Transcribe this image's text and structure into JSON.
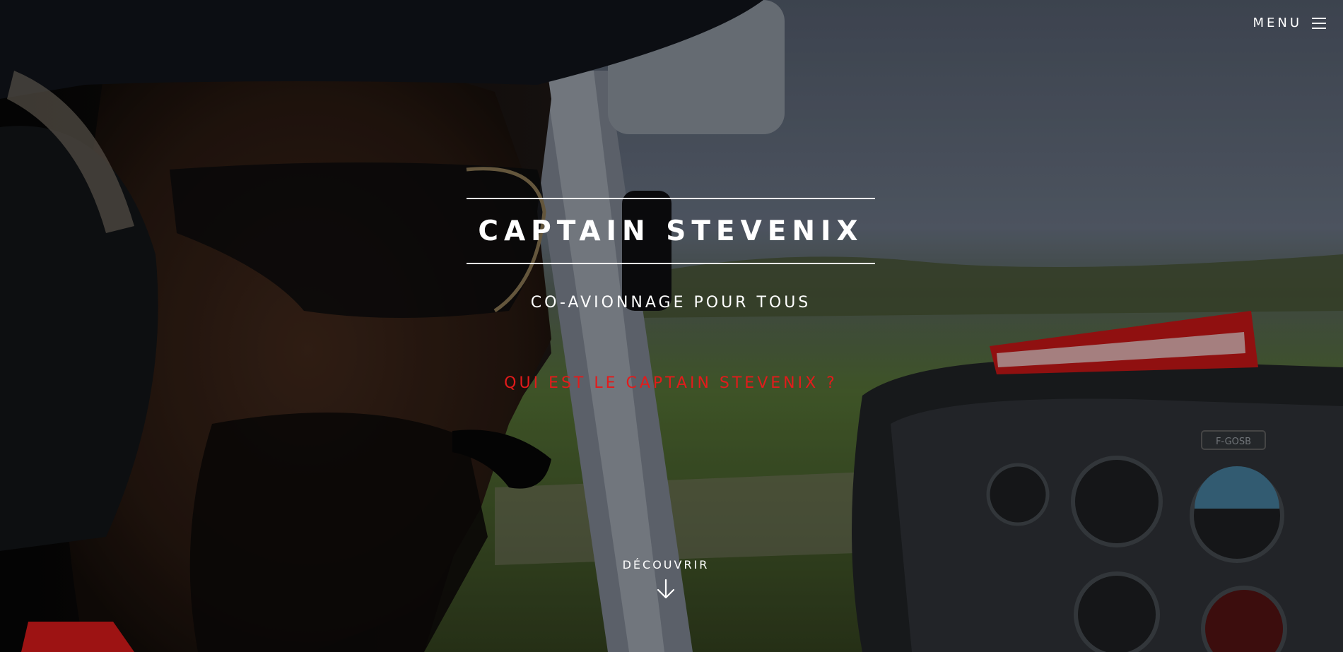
{
  "header": {
    "menu_label": "MENU",
    "menu_icon": "hamburger-icon"
  },
  "hero": {
    "title": "CAPTAIN STEVENIX",
    "tagline": "CO-AVIONNAGE POUR TOUS",
    "cta_label": "QUI EST LE CAPTAIN STEVENIX ?",
    "discover_label": "DÉCOUVRIR",
    "discover_icon": "arrow-down-icon",
    "background_image": "pilot-in-cockpit-photo"
  },
  "panel_placard": "F-GOSB",
  "colors": {
    "text": "#ffffff",
    "accent": "#e31b1b"
  }
}
